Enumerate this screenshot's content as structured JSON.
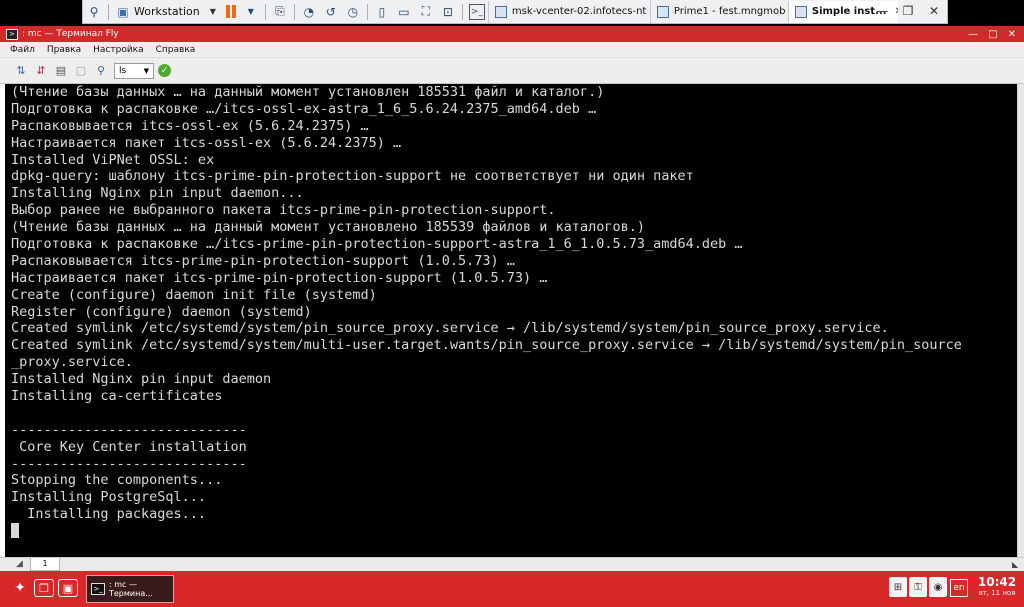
{
  "vm_toolbar": {
    "product": "Workstation",
    "tabs": [
      {
        "label": "msk-vcenter-02.infotecs-nt",
        "active": false
      },
      {
        "label": "Prime1 - fest.mngmob",
        "active": false
      },
      {
        "label": "Simple inst...",
        "active": true
      }
    ]
  },
  "terminal_window": {
    "title": ": mc — Терминал Fly",
    "menu": [
      "Файл",
      "Правка",
      "Настройка",
      "Справка"
    ],
    "session_select": "ls",
    "lines": [
      "(Чтение базы данных … на данный момент установлен 185531 файл и каталог.)",
      "Подготовка к распаковке …/itcs-ossl-ex-astra_1_6_5.6.24.2375_amd64.deb …",
      "Распаковывается itcs-ossl-ex (5.6.24.2375) …",
      "Настраивается пакет itcs-ossl-ex (5.6.24.2375) …",
      "Installed ViPNet OSSL: ex",
      "dpkg-query: шаблону itcs-prime-pin-protection-support не соответствует ни один пакет",
      "Installing Nginx pin input daemon...",
      "Выбор ранее не выбранного пакета itcs-prime-pin-protection-support.",
      "(Чтение базы данных … на данный момент установлено 185539 файлов и каталогов.)",
      "Подготовка к распаковке …/itcs-prime-pin-protection-support-astra_1_6_1.0.5.73_amd64.deb …",
      "Распаковывается itcs-prime-pin-protection-support (1.0.5.73) …",
      "Настраивается пакет itcs-prime-pin-protection-support (1.0.5.73) …",
      "Create (configure) daemon init file (systemd)",
      "Register (configure) daemon (systemd)",
      "Created symlink /etc/systemd/system/pin_source_proxy.service → /lib/systemd/system/pin_source_proxy.service.",
      "Created symlink /etc/systemd/system/multi-user.target.wants/pin_source_proxy.service → /lib/systemd/system/pin_source",
      "_proxy.service.",
      "Installed Nginx pin input daemon",
      "Installing ca-certificates",
      "",
      "-----------------------------",
      " Core Key Center installation",
      "-----------------------------",
      "Stopping the components...",
      "Installing PostgreSql...",
      "  Installing packages..."
    ],
    "tab_label": "1"
  },
  "taskbar": {
    "task_label": ": mc — Термина...",
    "lang": "en",
    "time": "10:42",
    "date": "вт, 11 ноя"
  }
}
